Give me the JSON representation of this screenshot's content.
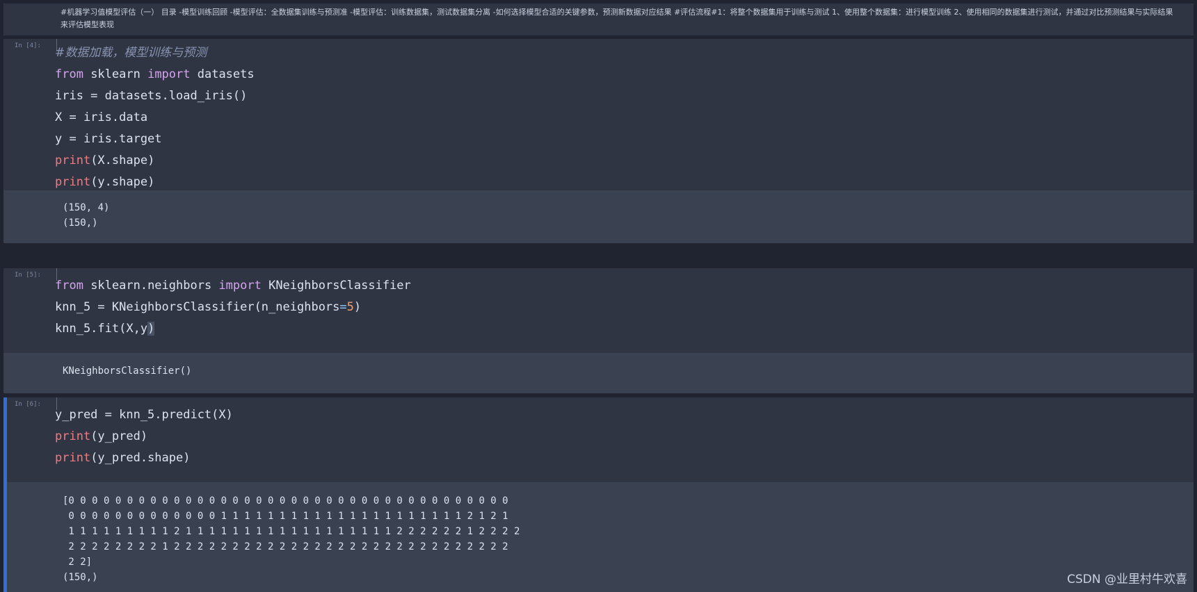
{
  "markdown": {
    "text": "#机器学习值模型评估（一） 目录 -模型训练回顾 -模型评估：全数据集训练与预测准 -模型评估：训练数据集，测试数据集分离 -如何选择模型合适的关键参数，预测新数据对应结果 #评估流程#1：将整个数据集用于训练与测试 1、使用整个数据集：进行模型训练 2、使用相同的数据集进行测试，并通过对比预测结果与实际结果来评估模型表现"
  },
  "cells": [
    {
      "prompt": "In [4]:",
      "code": {
        "line1": "#数据加载，模型训练与预测",
        "line2_kw1": "from",
        "line2_mid": " sklearn ",
        "line2_kw2": "import",
        "line2_end": " datasets",
        "line3": "iris = datasets.load_iris()",
        "line4": "X = iris.data",
        "line5": "y = iris.target",
        "line6_fn": "print",
        "line6_rest": "(X.shape)",
        "line7_fn": "print",
        "line7_rest": "(y.shape)"
      },
      "output": [
        "(150, 4)",
        "(150,)"
      ]
    },
    {
      "prompt": "In [5]:",
      "code": {
        "line1_kw1": "from",
        "line1_mid": " sklearn.neighbors ",
        "line1_kw2": "import",
        "line1_end": " KNeighborsClassifier",
        "line2_a": "knn_5 = KNeighborsClassifier(n_neighbors",
        "line2_op": "=",
        "line2_num": "5",
        "line2_end": ")",
        "line3_a": "knn_5.fit(X,y",
        "line3_b": ")"
      },
      "output": [
        "KNeighborsClassifier()"
      ]
    },
    {
      "prompt": "In [6]:",
      "code": {
        "line1": "y_pred = knn_5.predict(X)",
        "line2_fn": "print",
        "line2_rest": "(y_pred)",
        "line3_fn": "print",
        "line3_rest": "(y_pred.shape)"
      },
      "output": [
        "[0 0 0 0 0 0 0 0 0 0 0 0 0 0 0 0 0 0 0 0 0 0 0 0 0 0 0 0 0 0 0 0 0 0 0 0 0 0",
        " 0 0 0 0 0 0 0 0 0 0 0 0 0 1 1 1 1 1 1 1 1 1 1 1 1 1 1 1 1 1 1 1 1 1 2 1 2 1",
        " 1 1 1 1 1 1 1 1 1 2 1 1 1 1 1 1 1 1 1 1 1 1 1 1 1 1 1 1 2 2 2 2 2 2 1 2 2 2 2",
        " 2 2 2 2 2 2 2 2 1 2 2 2 2 2 2 2 2 2 2 2 2 2 2 2 2 2 2 2 2 2 2 2 2 2 2 2 2 2",
        " 2 2]",
        "(150,)"
      ]
    }
  ],
  "watermark": "CSDN @业里村牛欢喜",
  "colors": {
    "background": "#1f2430",
    "cell_input": "#2f3543",
    "cell_output": "#3a4252",
    "keyword": "#d7a3f0",
    "builtin": "#f07c82",
    "number": "#f0a070",
    "active_bar": "#2f6fd6"
  }
}
